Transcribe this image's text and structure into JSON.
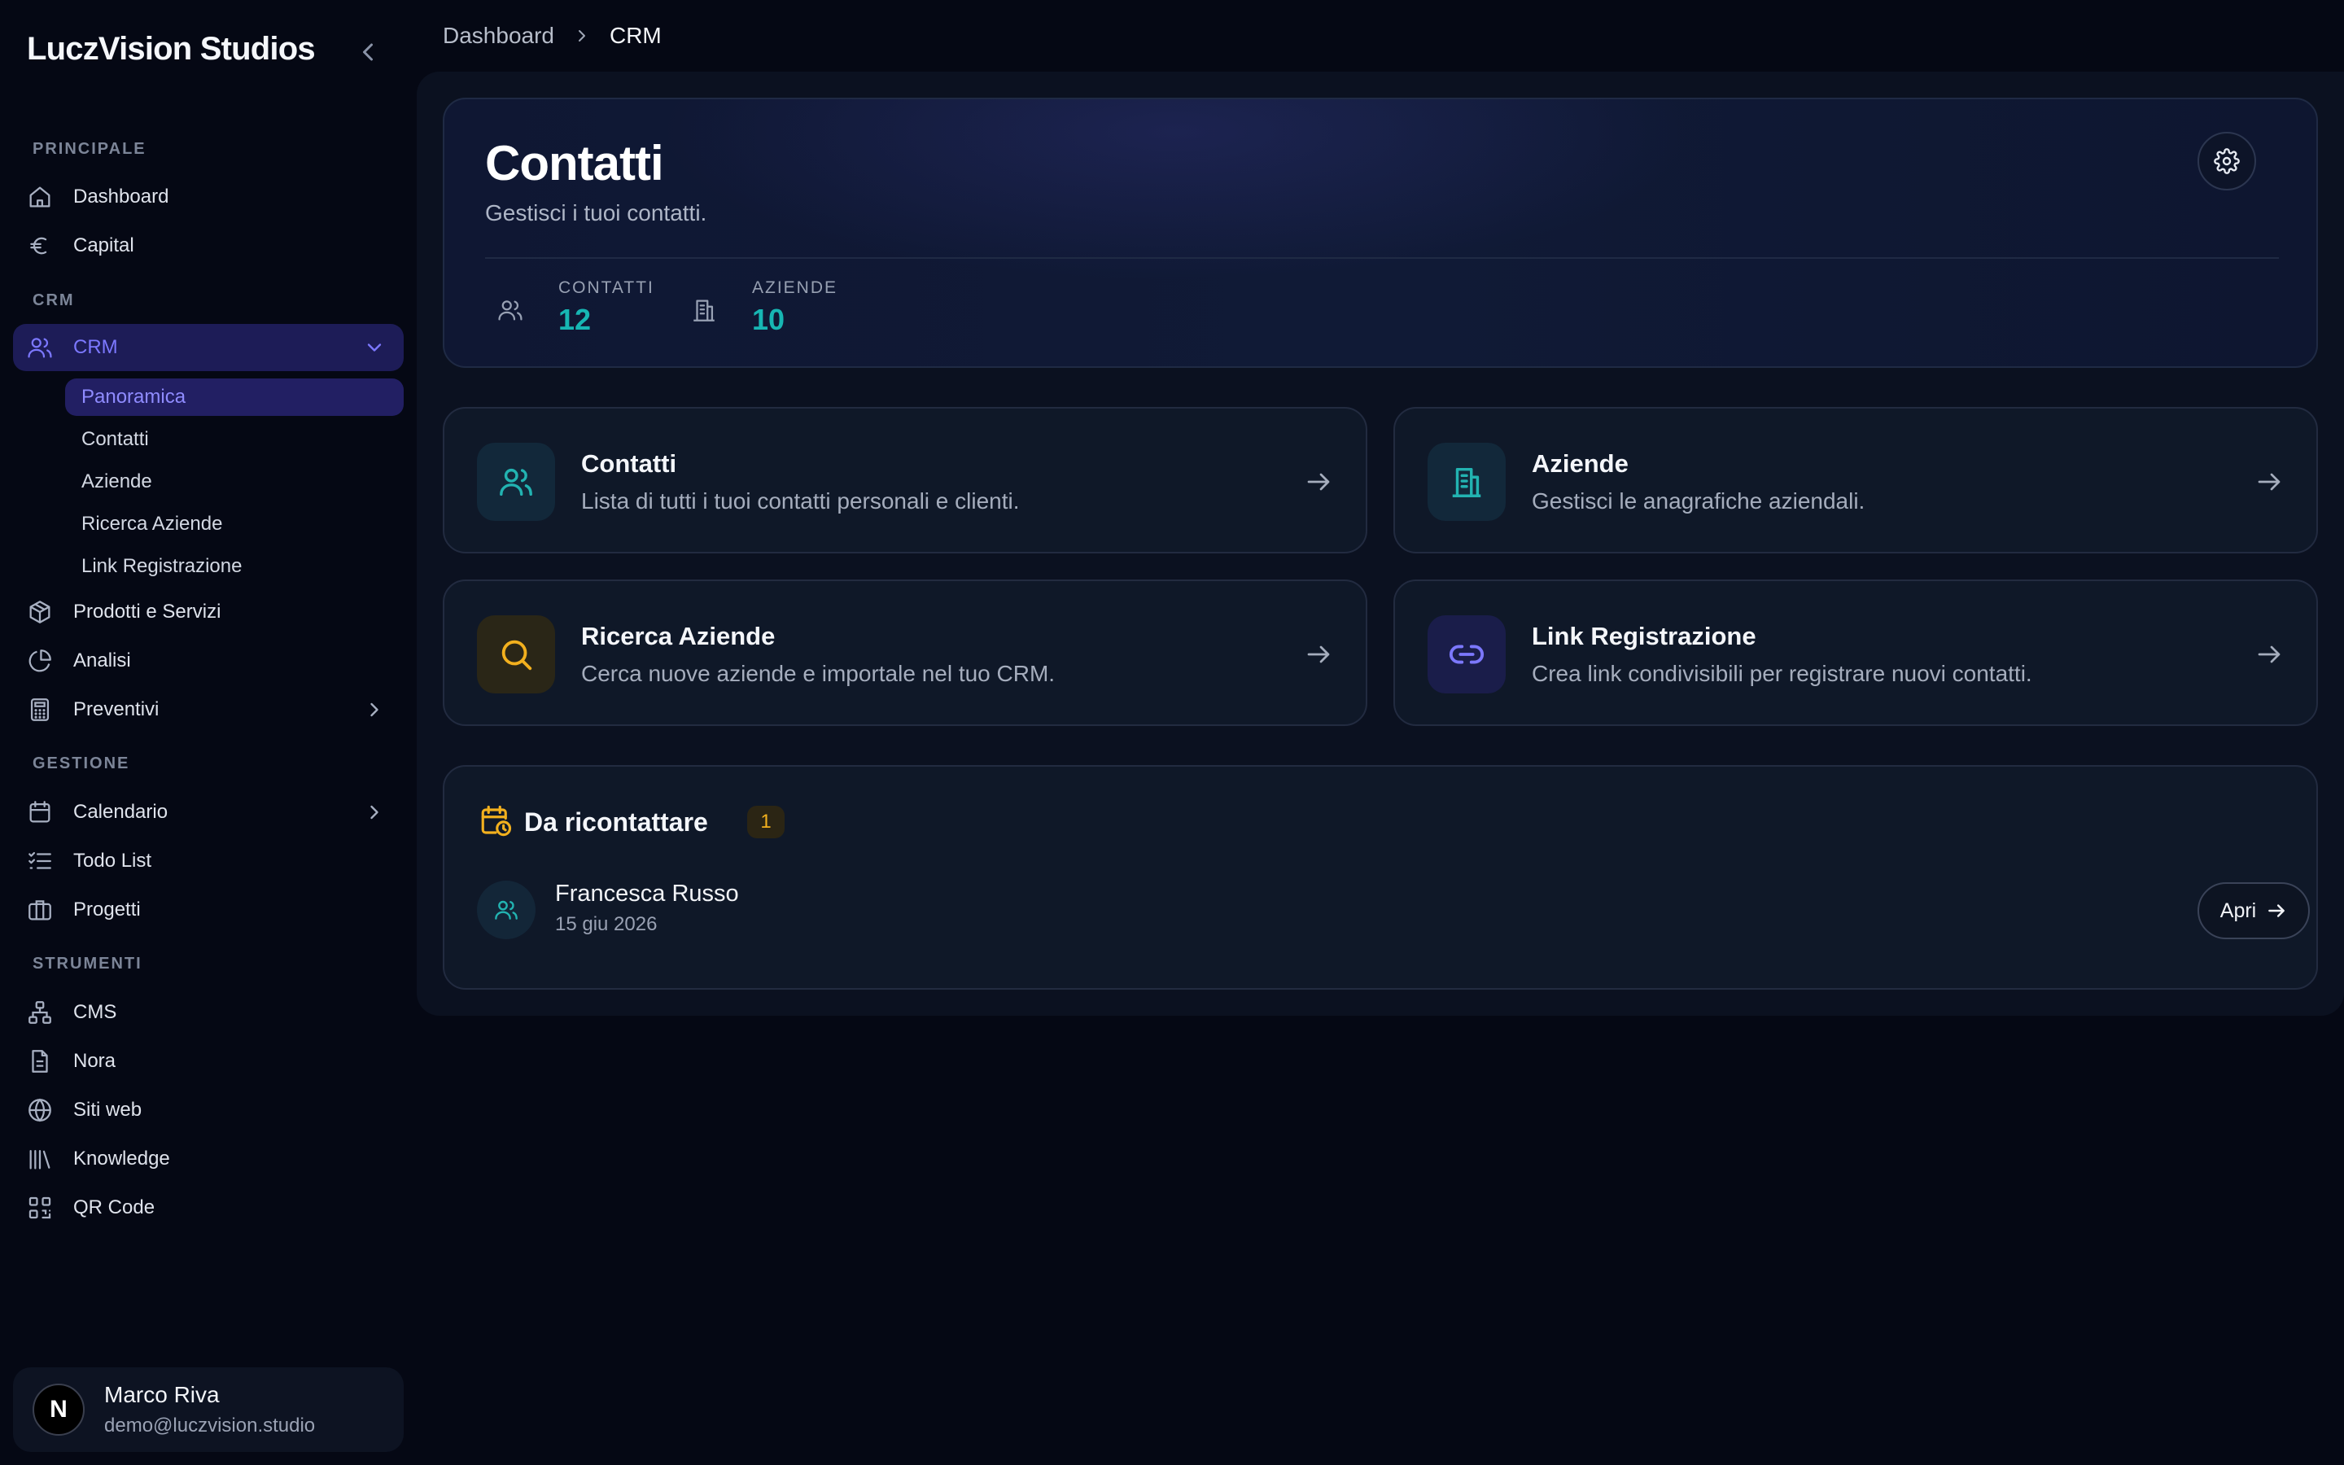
{
  "app": {
    "brand": "LuczVision Studios"
  },
  "sidebar": {
    "sections": {
      "principale": "PRINCIPALE",
      "crm": "CRM",
      "gestione": "GESTIONE",
      "strumenti": "STRUMENTI"
    },
    "items": {
      "dashboard": "Dashboard",
      "capital": "Capital",
      "crm": "CRM",
      "prodotti": "Prodotti e Servizi",
      "analisi": "Analisi",
      "preventivi": "Preventivi",
      "calendario": "Calendario",
      "todo": "Todo List",
      "progetti": "Progetti",
      "cms": "CMS",
      "nora": "Nora",
      "siti": "Siti web",
      "knowledge": "Knowledge",
      "qr": "QR Code"
    },
    "crm_sub": {
      "panoramica": "Panoramica",
      "contatti": "Contatti",
      "aziende": "Aziende",
      "ricerca": "Ricerca Aziende",
      "link": "Link Registrazione"
    }
  },
  "user": {
    "initial": "N",
    "name": "Marco Riva",
    "email": "demo@luczvision.studio"
  },
  "breadcrumb": {
    "root": "Dashboard",
    "current": "CRM"
  },
  "hero": {
    "title": "Contatti",
    "subtitle": "Gestisci i tuoi contatti.",
    "stats": {
      "contatti_label": "CONTATTI",
      "contatti_value": "12",
      "aziende_label": "AZIENDE",
      "aziende_value": "10"
    }
  },
  "cards": {
    "contatti": {
      "title": "Contatti",
      "desc": "Lista di tutti i tuoi contatti personali e clienti."
    },
    "aziende": {
      "title": "Aziende",
      "desc": "Gestisci le anagrafiche aziendali."
    },
    "ricerca": {
      "title": "Ricerca Aziende",
      "desc": "Cerca nuove aziende e importale nel tuo CRM."
    },
    "link": {
      "title": "Link Registrazione",
      "desc": "Crea link condivisibili per registrare nuovi contatti."
    }
  },
  "recall": {
    "title": "Da ricontattare",
    "count": "1",
    "person": {
      "name": "Francesca Russo",
      "date": "15 giu 2026"
    },
    "open_label": "Apri"
  },
  "colors": {
    "accent": "#7c78ff",
    "teal": "#17b6b3",
    "amber": "#f2b01e",
    "background": "#050814"
  }
}
